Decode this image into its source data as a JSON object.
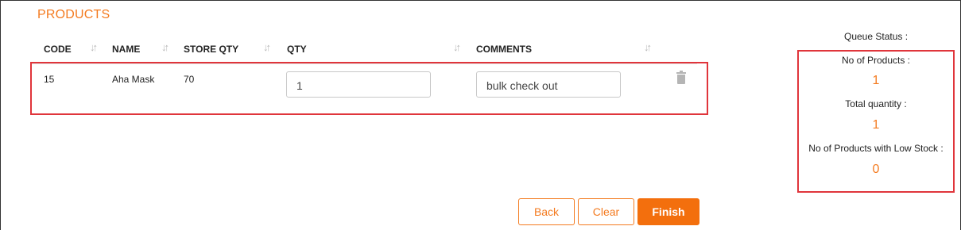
{
  "page": {
    "title": "PRODUCTS"
  },
  "table": {
    "columns": [
      "CODE",
      "NAME",
      "STORE QTY",
      "QTY",
      "COMMENTS"
    ],
    "rows": [
      {
        "code": "15",
        "name": "Aha Mask",
        "store_qty": "70",
        "qty": "1",
        "comments": "bulk check out"
      }
    ]
  },
  "queue": {
    "title": "Queue Status :",
    "products_label": "No of Products :",
    "products_value": "1",
    "quantity_label": "Total quantity :",
    "quantity_value": "1",
    "low_stock_label": "No of Products with Low Stock :",
    "low_stock_value": "0"
  },
  "buttons": {
    "back": "Back",
    "clear": "Clear",
    "finish": "Finish"
  },
  "colors": {
    "accent": "#f47b20",
    "highlight": "#e0353b",
    "primary_button": "#f36f0d"
  },
  "icons": {
    "sort": "sort-arrows-icon",
    "delete": "trash-icon"
  }
}
